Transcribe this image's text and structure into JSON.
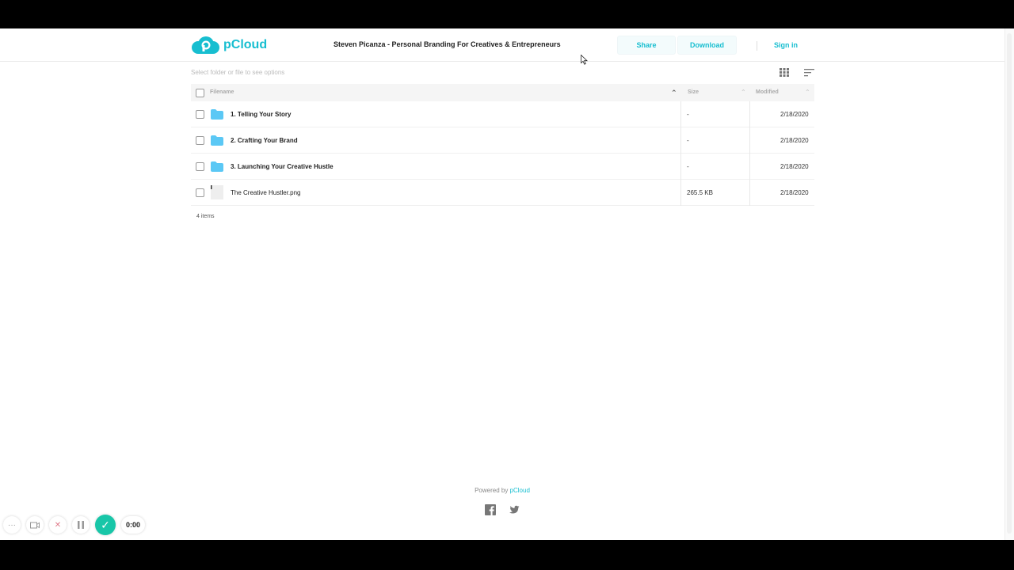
{
  "header": {
    "logo_text": "pCloud",
    "title": "Steven Picanza - Personal Branding For Creatives & Entrepreneurs",
    "share_label": "Share",
    "download_label": "Download",
    "signin_label": "Sign in"
  },
  "toolbar": {
    "hint": "Select folder or file to see options",
    "grid_icon": "grid-view-icon",
    "sort_icon": "sort-icon"
  },
  "table": {
    "columns": {
      "name": "Filename",
      "size": "Size",
      "modified": "Modified"
    },
    "rows": [
      {
        "name": "1. Telling Your Story",
        "size": "-",
        "modified": "2/18/2020",
        "type": "folder"
      },
      {
        "name": "2. Crafting Your Brand",
        "size": "-",
        "modified": "2/18/2020",
        "type": "folder"
      },
      {
        "name": "3. Launching Your Creative Hustle",
        "size": "-",
        "modified": "2/18/2020",
        "type": "folder"
      },
      {
        "name": "The Creative Hustler.png",
        "size": "265.5 KB",
        "modified": "2/18/2020",
        "type": "image"
      }
    ],
    "count": "4 items"
  },
  "footer": {
    "powered_prefix": "Powered by ",
    "powered_link": "pCloud"
  },
  "recorder": {
    "time": "0:00"
  },
  "colors": {
    "accent": "#17bed0",
    "folder": "#5bc8f5",
    "record_done": "#18c6a8"
  }
}
